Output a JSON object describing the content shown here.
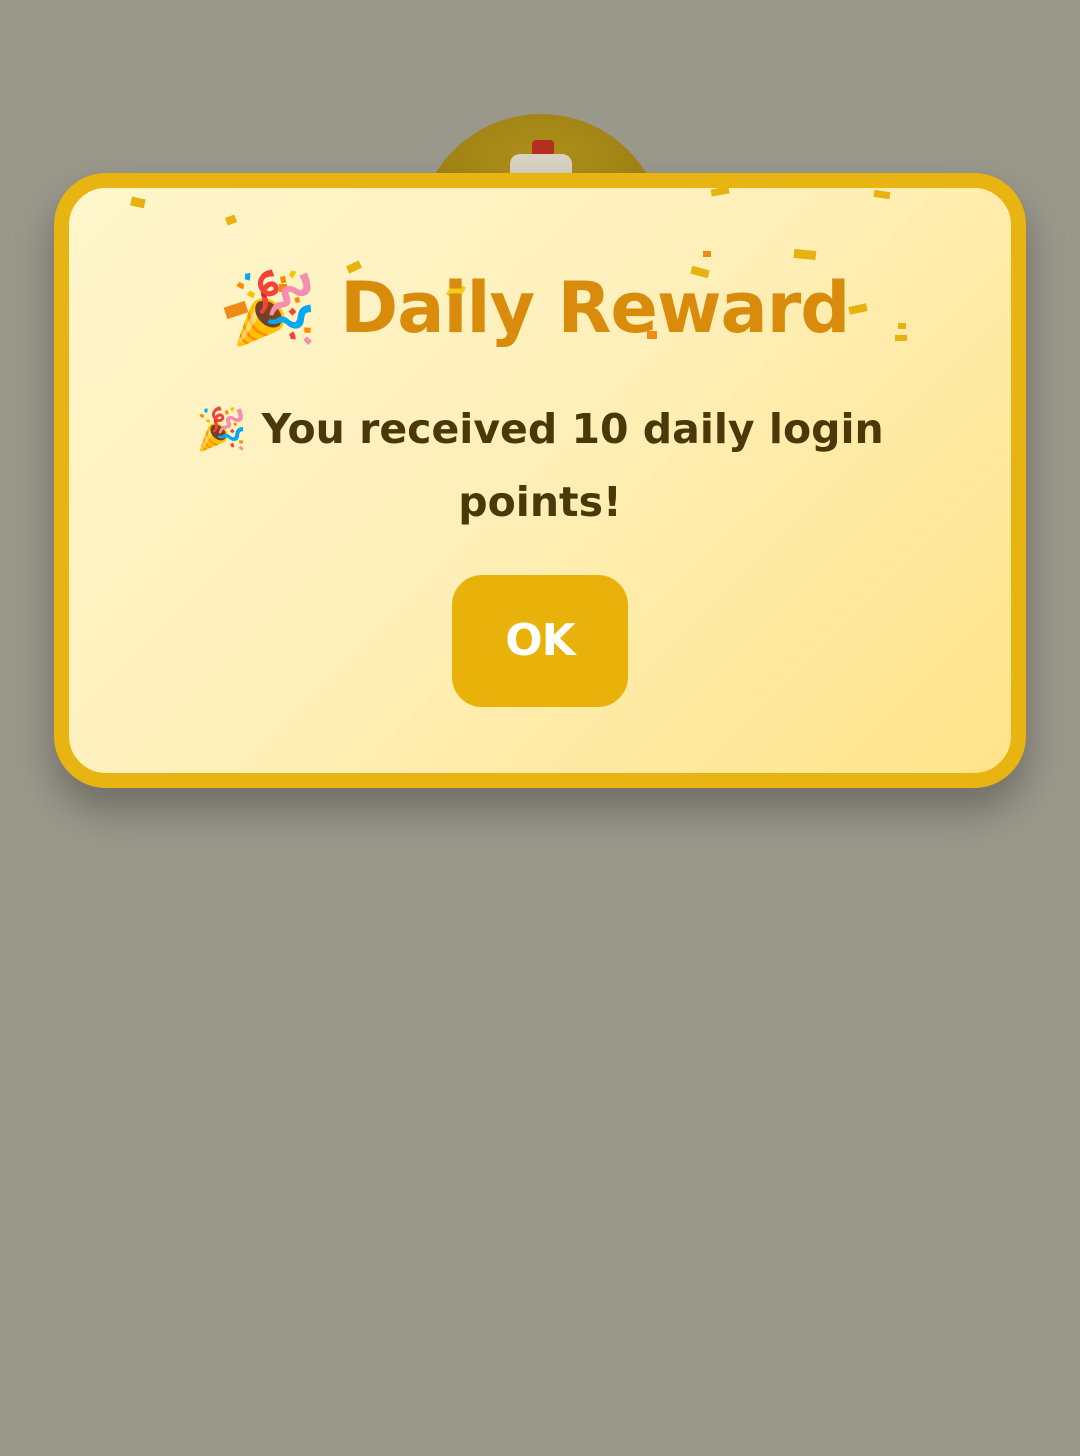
{
  "dialog": {
    "title": "🎉 Daily Reward",
    "message": "🎉 You received 10 daily login points!",
    "ok_label": "OK"
  },
  "colors": {
    "backdrop": "#9a978b",
    "dialog_border": "#e8b412",
    "title": "#d98c0c",
    "message": "#4a3808",
    "button": "#e8b20a",
    "confetti_gold": "#e6b20e",
    "confetti_orange": "#f08a12"
  },
  "icons": {
    "title_icon": "party-popper-icon",
    "message_icon": "party-popper-icon"
  }
}
